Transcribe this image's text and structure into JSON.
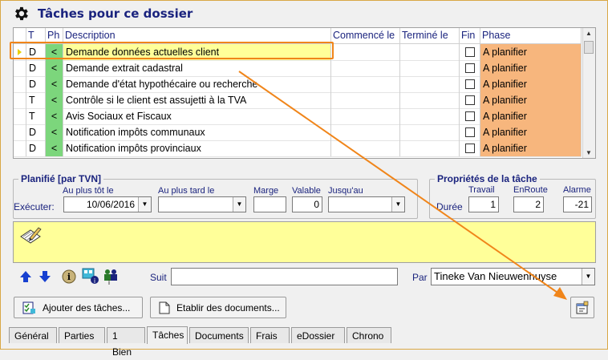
{
  "section": {
    "title": "Tâches pour ce dossier",
    "icon": "gear-icon"
  },
  "table": {
    "columns": [
      "T",
      "Ph",
      "Description",
      "Commencé le",
      "Terminé le",
      "Fin",
      "Phase"
    ],
    "rows": [
      {
        "t": "D",
        "ph": "<",
        "desc": "Demande données actuelles client",
        "phase": "A planifier",
        "selected": true
      },
      {
        "t": "D",
        "ph": "<",
        "desc": "Demande extrait cadastral",
        "phase": "A planifier"
      },
      {
        "t": "D",
        "ph": "<",
        "desc": "Demande d'état hypothécaire ou recherche",
        "phase": "A planifier"
      },
      {
        "t": "T",
        "ph": "<",
        "desc": "Contrôle si le client est assujetti à la TVA",
        "phase": "A planifier"
      },
      {
        "t": "T",
        "ph": "<",
        "desc": "Avis Sociaux et Fiscaux",
        "phase": "A planifier"
      },
      {
        "t": "D",
        "ph": "<",
        "desc": "Notification impôts communaux",
        "phase": "A planifier"
      },
      {
        "t": "D",
        "ph": "<",
        "desc": "Notification impôts provinciaux",
        "phase": "A planifier"
      }
    ]
  },
  "planifie": {
    "title": "Planifié  [par TVN]",
    "executer_label": "Exécuter:",
    "au_plus_tot_label": "Au plus tôt le",
    "au_plus_tot_value": "10/06/2016",
    "au_plus_tard_label": "Au plus tard le",
    "au_plus_tard_value": "",
    "marge_label": "Marge",
    "marge_value": "",
    "valable_label": "Valable",
    "valable_value": "0",
    "jusquau_label": "Jusqu'au",
    "jusquau_value": ""
  },
  "proprietes": {
    "title": "Propriétés de la tâche",
    "duree_label": "Durée",
    "travail_label": "Travail",
    "travail_value": "1",
    "enroute_label": "EnRoute",
    "enroute_value": "2",
    "alarme_label": "Alarme",
    "alarme_value": "-21"
  },
  "follow": {
    "suit_label": "Suit",
    "suit_value": "",
    "par_label": "Par",
    "par_value": "Tineke Van Nieuwenhuyse"
  },
  "buttons": {
    "ajouter": "Ajouter des tâches...",
    "etablir": "Etablir des documents..."
  },
  "tabs": [
    "Général",
    "Parties",
    "1 Bien",
    "Tâches",
    "Documents",
    "Frais",
    "eDossier",
    "Chrono"
  ],
  "active_tab": "Tâches",
  "colors": {
    "title": "#1a237e",
    "ph_green": "#7cd67c",
    "phase_orange": "#f7b67d",
    "notes_yellow": "#ffff99",
    "annotation_orange": "#f0851a"
  }
}
